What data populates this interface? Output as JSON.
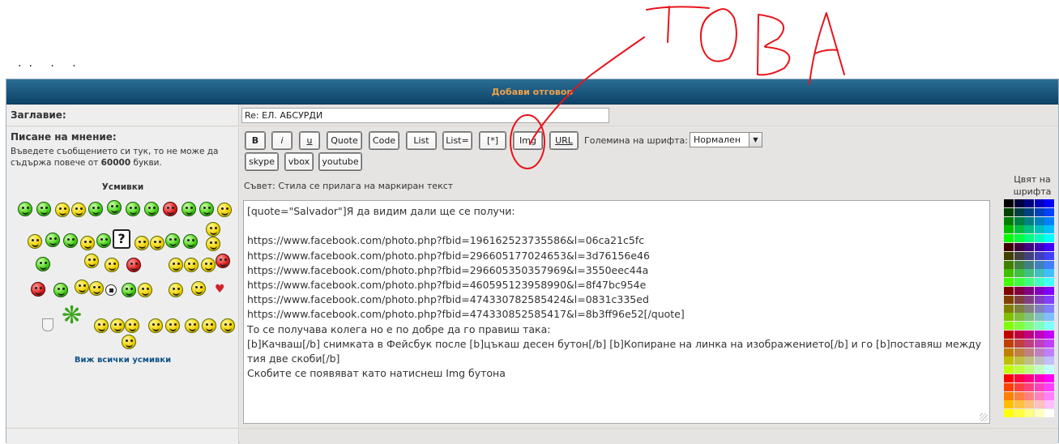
{
  "top": {
    "dots": ".. .   ."
  },
  "panel": {
    "title": "Добави отговор"
  },
  "subject": {
    "label": "Заглавие:",
    "value": "Re: ЕЛ. АБСУРДИ"
  },
  "message": {
    "label": "Писане на мнение:",
    "description_pre": "Въведете съобщението си тук, то не може да съдържа повече от ",
    "description_bold": "60000",
    "description_post": " букви."
  },
  "smilies": {
    "title": "Усмивки",
    "view_all": "Виж всички усмивки"
  },
  "toolbar": {
    "buttons": [
      "B",
      "i",
      "u",
      "Quote",
      "Code",
      "List",
      "List=",
      "[*]",
      "Img",
      "URL"
    ],
    "buttons2": [
      "skype",
      "vbox",
      "youtube"
    ],
    "font_size_label": "Големина на шрифта:",
    "font_size_value": "Нормален"
  },
  "hint": "Съвет: Стила се прилага на маркиран текст",
  "color_title": "Цвят на шрифта",
  "textarea_lines": [
    "[quote=\"Salvador\"]Я да видим дали ще се получи:",
    "",
    "https://www.facebook.com/photo.php?fbid=196162523735586&l=06ca21c5fc",
    "https://www.facebook.com/photo.php?fbid=296605177024653&l=3d76156e46",
    "https://www.facebook.com/photo.php?fbid=296605350357969&l=3550eec44a",
    "https://www.facebook.com/photo.php?fbid=460595123958990&l=8f47bc954e",
    "https://www.facebook.com/photo.php?fbid=474330782585424&l=0831c335ed",
    "https://www.facebook.com/photo.php?fbid=474330852585417&l=8b3ff96e52[/quote]",
    "То се получава колега но е по добре да го правиш така:",
    "[b]Качваш[/b] снимката в Фейсбук после [b]цъкаш десен бутон[/b] [b]Копиране на линка на изображението[/b] и го [b]поставяш между тия две скоби[/b]",
    "Скобите се появяват като натиснеш Img бутона"
  ],
  "annotation": {
    "text": "ТОВА",
    "color": "#e8141c"
  },
  "colors": {
    "header": "#1d5a80",
    "title": "#f0a34a",
    "link": "#105289"
  }
}
